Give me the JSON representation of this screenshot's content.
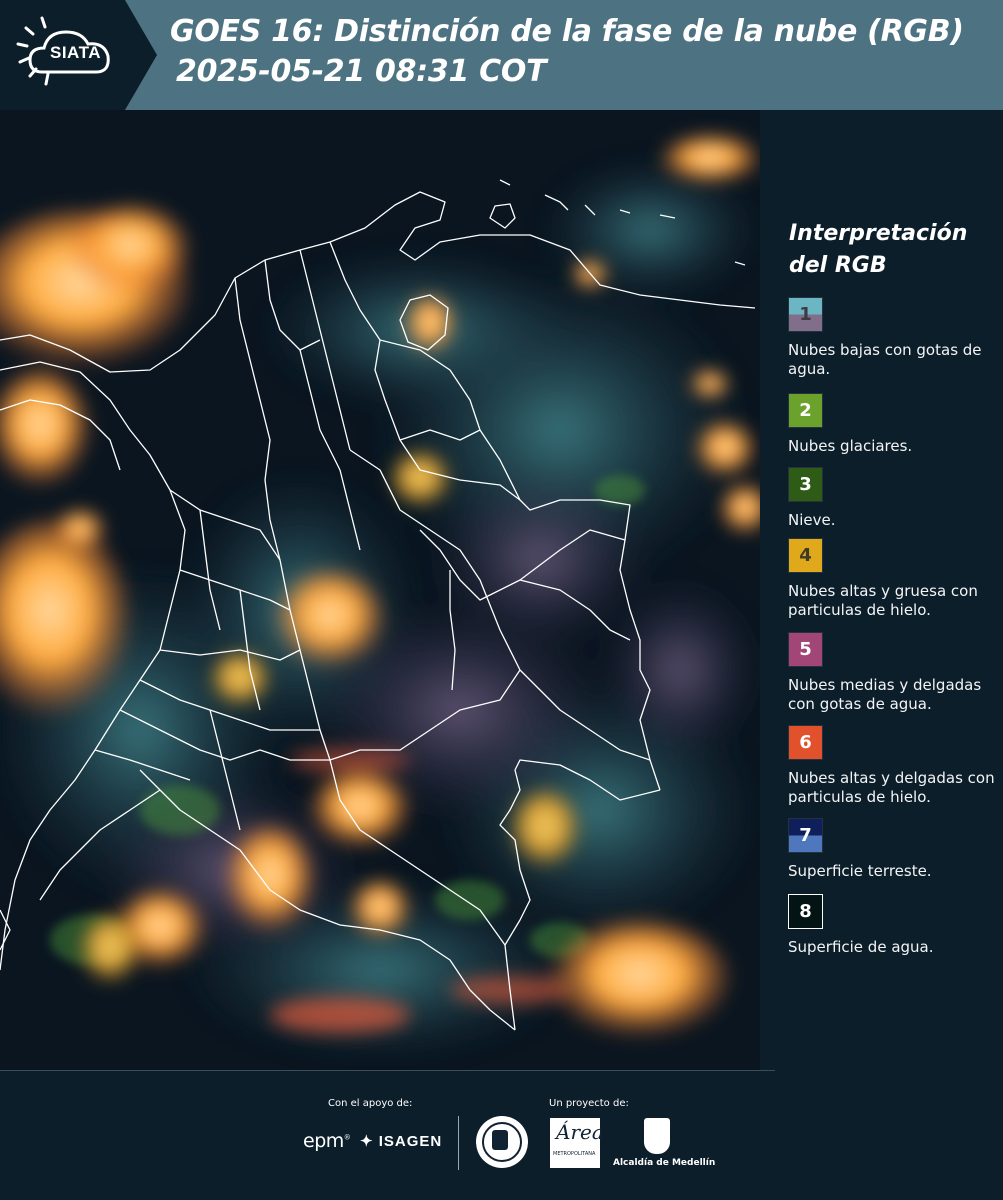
{
  "header": {
    "logo_text": "SIATA",
    "title": "GOES 16: Distinción de la fase de la nube (RGB)",
    "subtitle": "2025-05-21 08:31 COT",
    "colors": {
      "banner": "#4d7282",
      "logo_bg": "#0d1e2b"
    }
  },
  "map": {
    "description_icon": "satellite-rgb-cloud-phase-image",
    "colors": {
      "background": "#0b1824",
      "boundaries": "#ffffff",
      "cloud_high_thick": "#ffa637"
    }
  },
  "legend": {
    "title": "Interpretación del RGB",
    "items": [
      {
        "number": "1",
        "label": "Nubes bajas con gotas de agua.",
        "color_top": "#6cb6c3",
        "color_bottom": "#806e8b",
        "number_color": "#3d3a44"
      },
      {
        "number": "2",
        "label": "Nubes glaciares.",
        "color_top": "#6aa22b",
        "color_bottom": "#6aa22b",
        "number_color": "#ffffff"
      },
      {
        "number": "3",
        "label": "Nieve.",
        "color_top": "#2e5c16",
        "color_bottom": "#2e5c16",
        "number_color": "#ffffff"
      },
      {
        "number": "4",
        "label": "Nubes altas y gruesa con particulas de hielo.",
        "color_top": "#e0a81b",
        "color_bottom": "#e0a81b",
        "number_color": "#3d3a2a"
      },
      {
        "number": "5",
        "label": "Nubes medias y delgadas con gotas de agua.",
        "color_top": "#a24677",
        "color_bottom": "#a24677",
        "number_color": "#ffffff"
      },
      {
        "number": "6",
        "label": "Nubes altas y delgadas con particulas de hielo.",
        "color_top": "#e1512b",
        "color_bottom": "#e1512b",
        "number_color": "#ffffff"
      },
      {
        "number": "7",
        "label": "Superficie terreste.",
        "color_top": "#0f1f5c",
        "color_bottom": "#4f77bd",
        "number_color": "#ffffff"
      },
      {
        "number": "8",
        "label": "Superficie de agua.",
        "color_top": "#041414",
        "color_bottom": "#041414",
        "number_color": "#ffffff"
      }
    ]
  },
  "footer": {
    "support_label": "Con el apoyo de:",
    "project_label": "Un proyecto de:",
    "epm_label": "epm",
    "isagen_label": "ISAGEN",
    "area_script": "Área",
    "area_small": "METROPOLITANA",
    "alcaldia_label": "Alcaldía de Medellín"
  }
}
